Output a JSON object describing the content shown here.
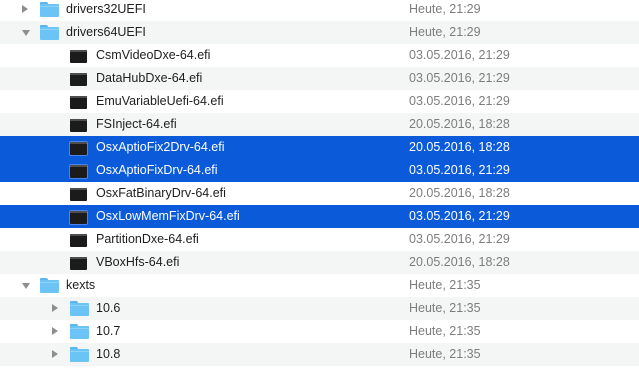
{
  "file_list": {
    "rows": [
      {
        "name": "drivers32UEFI",
        "date": "Heute, 21:29",
        "kind": "folder",
        "disclosure": "closed",
        "selected": false
      },
      {
        "name": "drivers64UEFI",
        "date": "Heute, 21:29",
        "kind": "folder",
        "disclosure": "open",
        "selected": false
      },
      {
        "name": "CsmVideoDxe-64.efi",
        "date": "03.05.2016, 21:29",
        "kind": "exec",
        "disclosure": "none",
        "selected": false
      },
      {
        "name": "DataHubDxe-64.efi",
        "date": "03.05.2016, 21:29",
        "kind": "exec",
        "disclosure": "none",
        "selected": false
      },
      {
        "name": "EmuVariableUefi-64.efi",
        "date": "03.05.2016, 21:29",
        "kind": "exec",
        "disclosure": "none",
        "selected": false
      },
      {
        "name": "FSInject-64.efi",
        "date": "20.05.2016, 18:28",
        "kind": "exec",
        "disclosure": "none",
        "selected": false
      },
      {
        "name": "OsxAptioFix2Drv-64.efi",
        "date": "20.05.2016, 18:28",
        "kind": "exec",
        "disclosure": "none",
        "selected": true
      },
      {
        "name": "OsxAptioFixDrv-64.efi",
        "date": "03.05.2016, 21:29",
        "kind": "exec",
        "disclosure": "none",
        "selected": true
      },
      {
        "name": "OsxFatBinaryDrv-64.efi",
        "date": "20.05.2016, 18:28",
        "kind": "exec",
        "disclosure": "none",
        "selected": false
      },
      {
        "name": "OsxLowMemFixDrv-64.efi",
        "date": "03.05.2016, 21:29",
        "kind": "exec",
        "disclosure": "none",
        "selected": true
      },
      {
        "name": "PartitionDxe-64.efi",
        "date": "03.05.2016, 21:29",
        "kind": "exec",
        "disclosure": "none",
        "selected": false
      },
      {
        "name": "VBoxHfs-64.efi",
        "date": "20.05.2016, 18:28",
        "kind": "exec",
        "disclosure": "none",
        "selected": false
      },
      {
        "name": "kexts",
        "date": "Heute, 21:35",
        "kind": "folder",
        "disclosure": "open",
        "selected": false
      },
      {
        "name": "10.6",
        "date": "Heute, 21:35",
        "kind": "folder",
        "disclosure": "closed",
        "selected": false
      },
      {
        "name": "10.7",
        "date": "Heute, 21:35",
        "kind": "folder",
        "disclosure": "closed",
        "selected": false
      },
      {
        "name": "10.8",
        "date": "Heute, 21:35",
        "kind": "folder",
        "disclosure": "closed",
        "selected": false
      }
    ]
  },
  "colors": {
    "selection": "#0b5ad9",
    "alternate_row": "#f4f5f5",
    "folder": "#6cc3f5",
    "date_text": "#7d7d7d"
  }
}
